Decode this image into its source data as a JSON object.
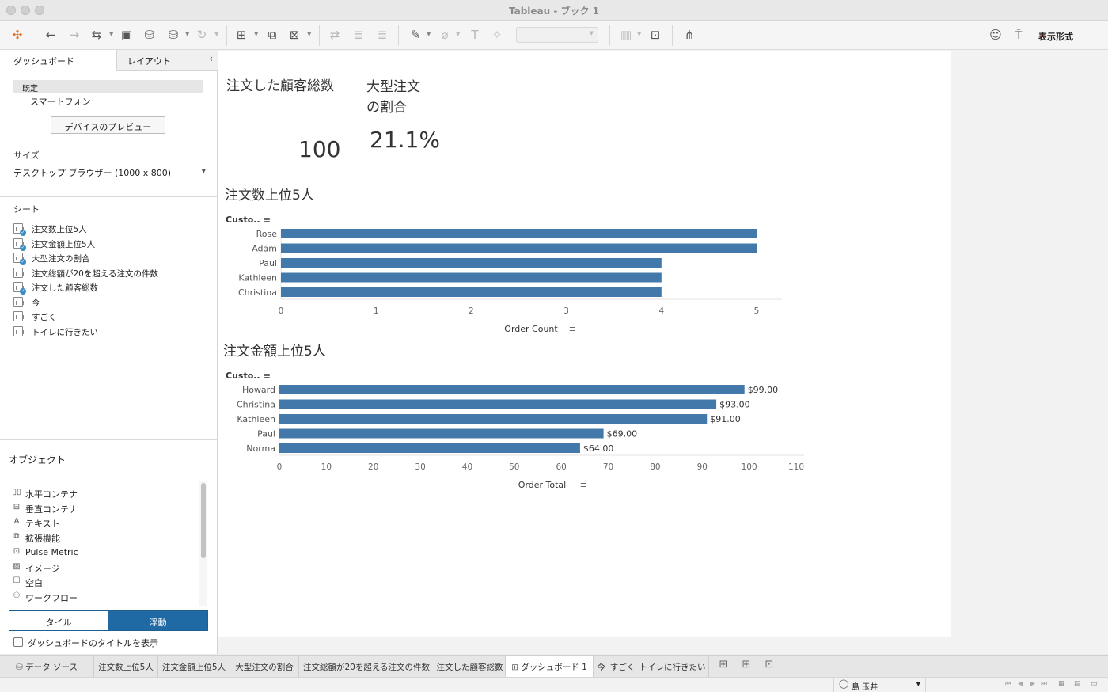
{
  "window": {
    "title": "Tableau - ブック 1"
  },
  "toolbar": {
    "display_mode_label": "表示形式"
  },
  "left_panel": {
    "tabs": {
      "dashboard": "ダッシュボード",
      "layout": "レイアウト"
    },
    "device": {
      "default": "既定",
      "phone": "スマートフォン",
      "preview_button": "デバイスのプレビュー"
    },
    "size": {
      "label": "サイズ",
      "value": "デスクトップ ブラウザー (1000 x 800)"
    },
    "sheets": {
      "label": "シート",
      "items": [
        {
          "label": "注文数上位5人",
          "used": true
        },
        {
          "label": "注文金額上位5人",
          "used": true
        },
        {
          "label": "大型注文の割合",
          "used": true
        },
        {
          "label": "注文総額が20を超える注文の件数",
          "used": false
        },
        {
          "label": "注文した顧客総数",
          "used": true
        },
        {
          "label": "今",
          "used": false
        },
        {
          "label": "すごく",
          "used": false
        },
        {
          "label": "トイレに行きたい",
          "used": false
        }
      ]
    },
    "objects": {
      "label": "オブジェクト",
      "items": [
        {
          "label": "水平コンテナ",
          "icon": "horizontal-container-icon"
        },
        {
          "label": "垂直コンテナ",
          "icon": "vertical-container-icon"
        },
        {
          "label": "テキスト",
          "icon": "text-icon"
        },
        {
          "label": "拡張機能",
          "icon": "extension-icon"
        },
        {
          "label": "Pulse Metric",
          "icon": "pulse-metric-icon"
        },
        {
          "label": "イメージ",
          "icon": "image-icon"
        },
        {
          "label": "空白",
          "icon": "blank-icon"
        },
        {
          "label": "ワークフロー",
          "icon": "workflow-icon"
        }
      ],
      "tile": "タイル",
      "float": "浮動",
      "show_title": "ダッシュボードのタイトルを表示"
    }
  },
  "dashboard": {
    "kpi1": {
      "title": "注文した顧客総数",
      "value": "100"
    },
    "kpi2": {
      "title_line1": "大型注文",
      "title_line2": "の割合",
      "value": "21.1%"
    },
    "chart1_title": "注文数上位5人",
    "chart2_title": "注文金額上位5人"
  },
  "chart_data": [
    {
      "type": "bar",
      "orientation": "horizontal",
      "title": "注文数上位5人",
      "row_header": "Custo..",
      "categories": [
        "Rose",
        "Adam",
        "Paul",
        "Kathleen",
        "Christina"
      ],
      "values": [
        5,
        5,
        4,
        4,
        4
      ],
      "xlabel": "Order Count",
      "xlim": [
        0,
        5
      ],
      "ticks": [
        0,
        1,
        2,
        3,
        4,
        5
      ],
      "color": "#4378ab"
    },
    {
      "type": "bar",
      "orientation": "horizontal",
      "title": "注文金額上位5人",
      "row_header": "Custo..",
      "categories": [
        "Howard",
        "Christina",
        "Kathleen",
        "Paul",
        "Norma"
      ],
      "values": [
        99,
        93,
        91,
        69,
        64
      ],
      "data_labels": [
        "$99.00",
        "$93.00",
        "$91.00",
        "$69.00",
        "$64.00"
      ],
      "xlabel": "Order Total",
      "xlim": [
        0,
        110
      ],
      "ticks": [
        0,
        10,
        20,
        30,
        40,
        50,
        60,
        70,
        80,
        90,
        100,
        110
      ],
      "color": "#4378ab"
    }
  ],
  "bottom_tabs": [
    {
      "label": "データ ソース",
      "icon": "datasource-icon"
    },
    {
      "label": "注文数上位5人"
    },
    {
      "label": "注文金額上位5人"
    },
    {
      "label": "大型注文の割合"
    },
    {
      "label": "注文総額が20を超える注文の件数"
    },
    {
      "label": "注文した顧客総数"
    },
    {
      "label": "ダッシュボード 1",
      "active": true
    },
    {
      "label": "今"
    },
    {
      "label": "すごく"
    },
    {
      "label": "トイレに行きたい"
    }
  ],
  "status": {
    "user": "島 玉井"
  }
}
